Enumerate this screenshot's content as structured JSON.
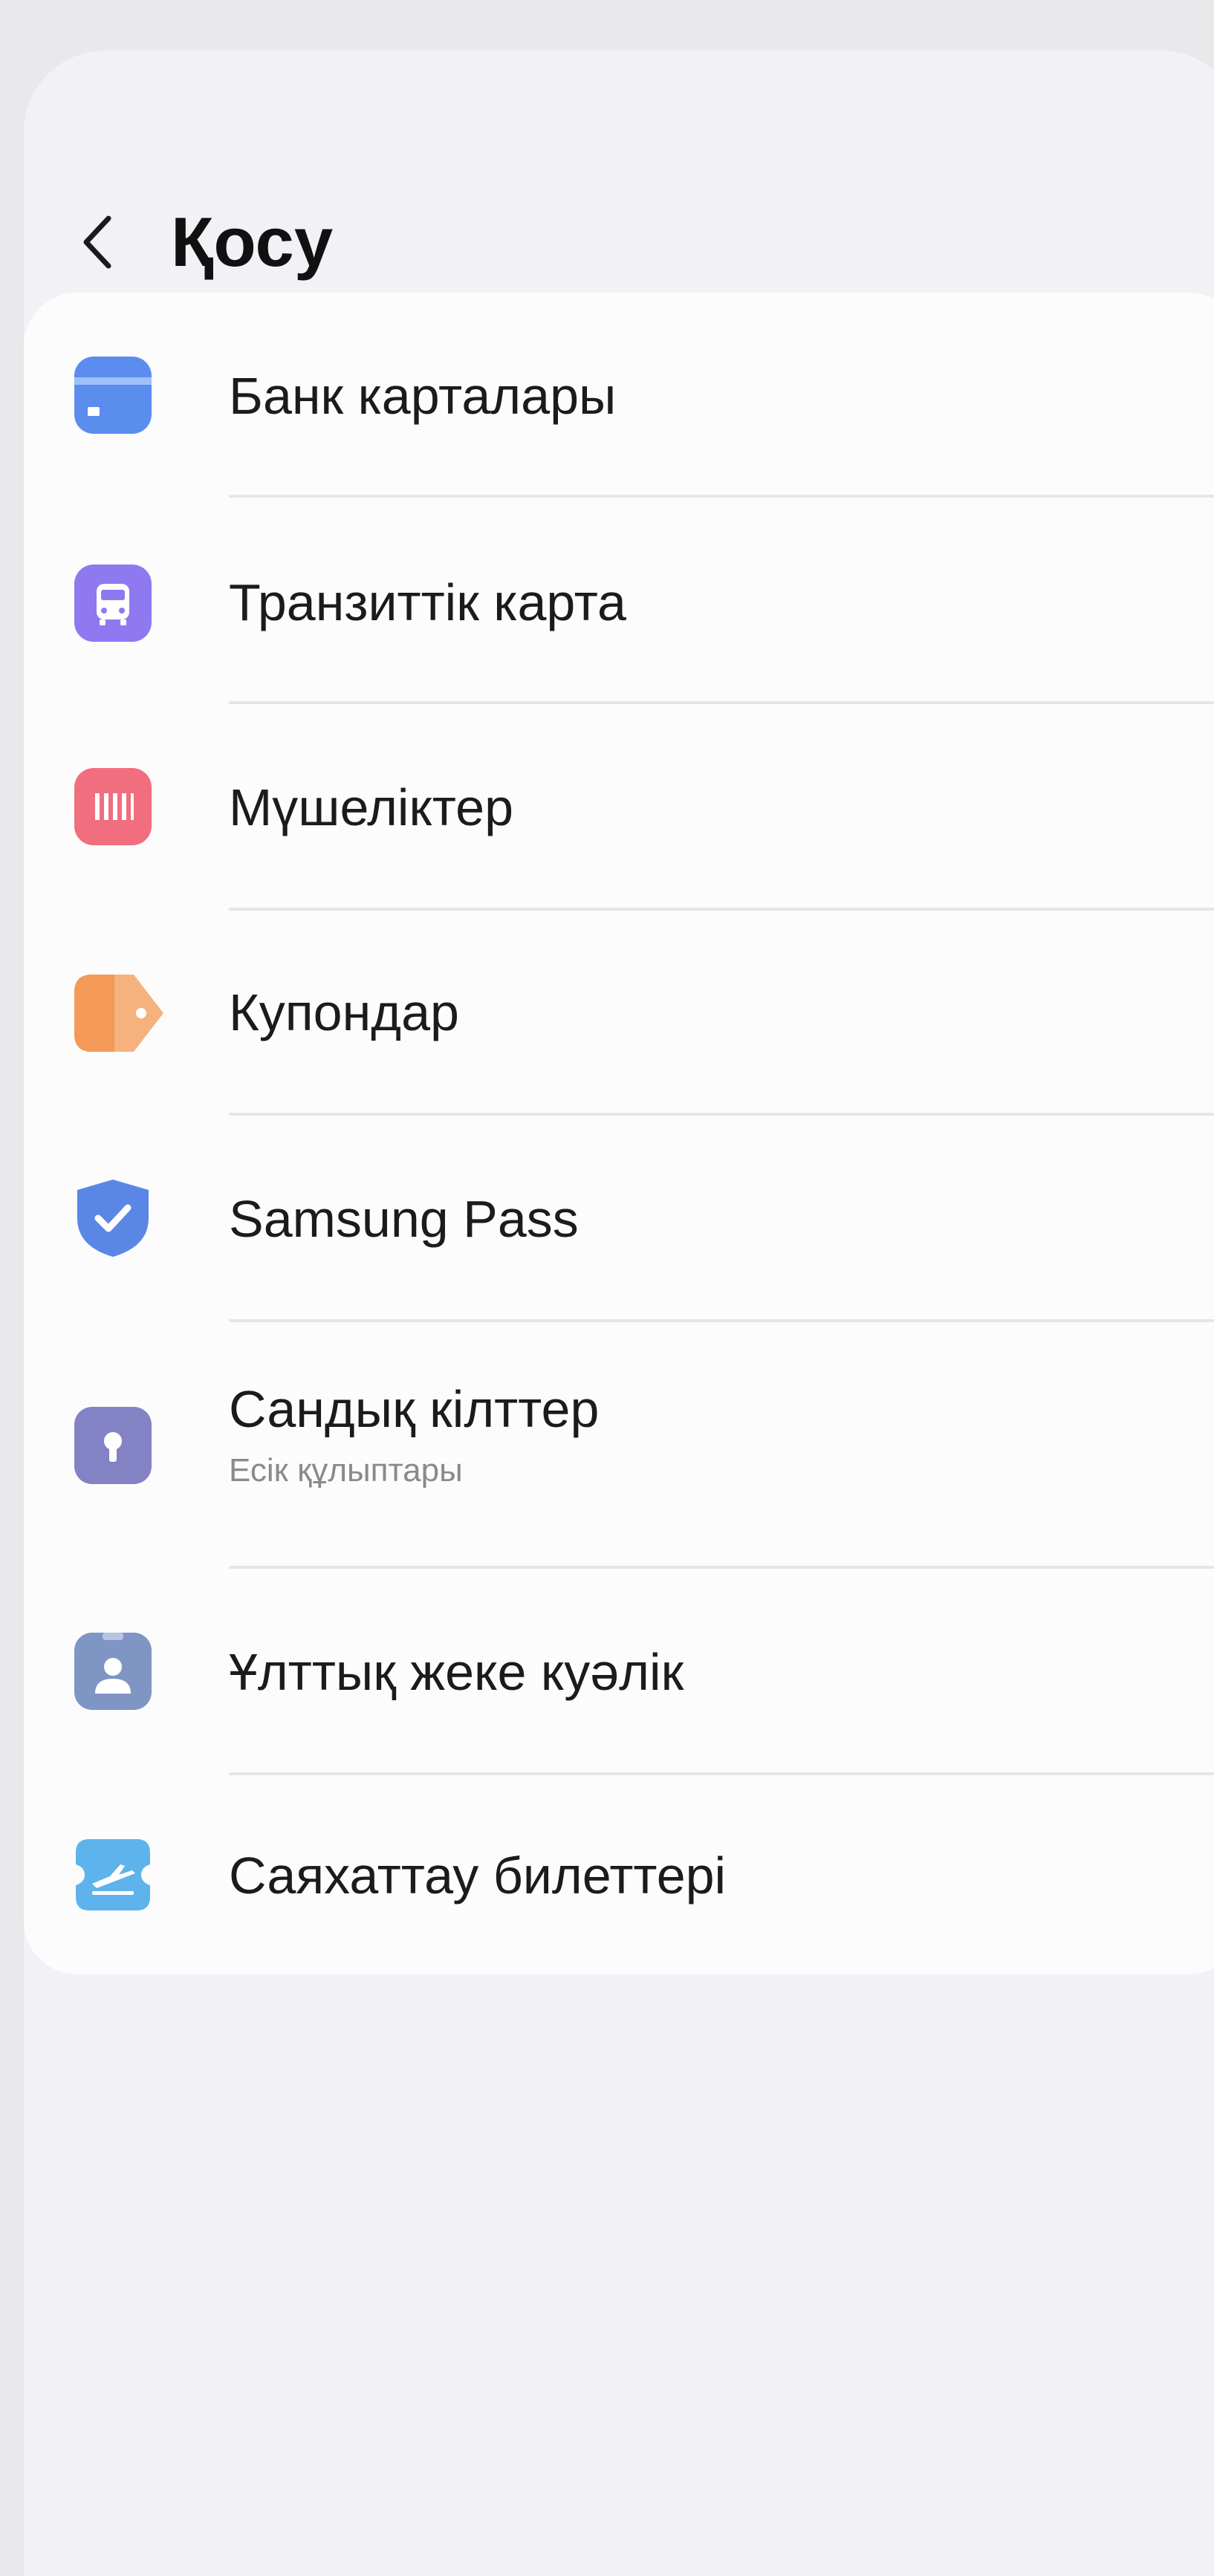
{
  "header": {
    "back_icon": "chevron-left-icon",
    "title": "Қосу"
  },
  "items": [
    {
      "label": "Банк карталары",
      "icon": "bank-card-icon",
      "color": "#5b8def"
    },
    {
      "label": "Транзиттік карта",
      "icon": "transit-bus-icon",
      "color": "#8e79f0"
    },
    {
      "label": "Мүшеліктер",
      "icon": "membership-barcode-icon",
      "color": "#f06e7e"
    },
    {
      "label": "Купондар",
      "icon": "coupon-tag-icon",
      "color": "#f39a58"
    },
    {
      "label": "Samsung Pass",
      "icon": "shield-check-icon",
      "color": "#5a87e6"
    },
    {
      "label": "Сандық кілттер",
      "sublabel": "Есік құлыптары",
      "icon": "digital-key-icon",
      "color": "#8382c4"
    },
    {
      "label": "Ұлттық жеке куәлік",
      "icon": "id-card-icon",
      "color": "#7f95c4"
    },
    {
      "label": "Саяхаттау билеттері",
      "icon": "travel-ticket-icon",
      "color": "#5fb3ec"
    }
  ]
}
